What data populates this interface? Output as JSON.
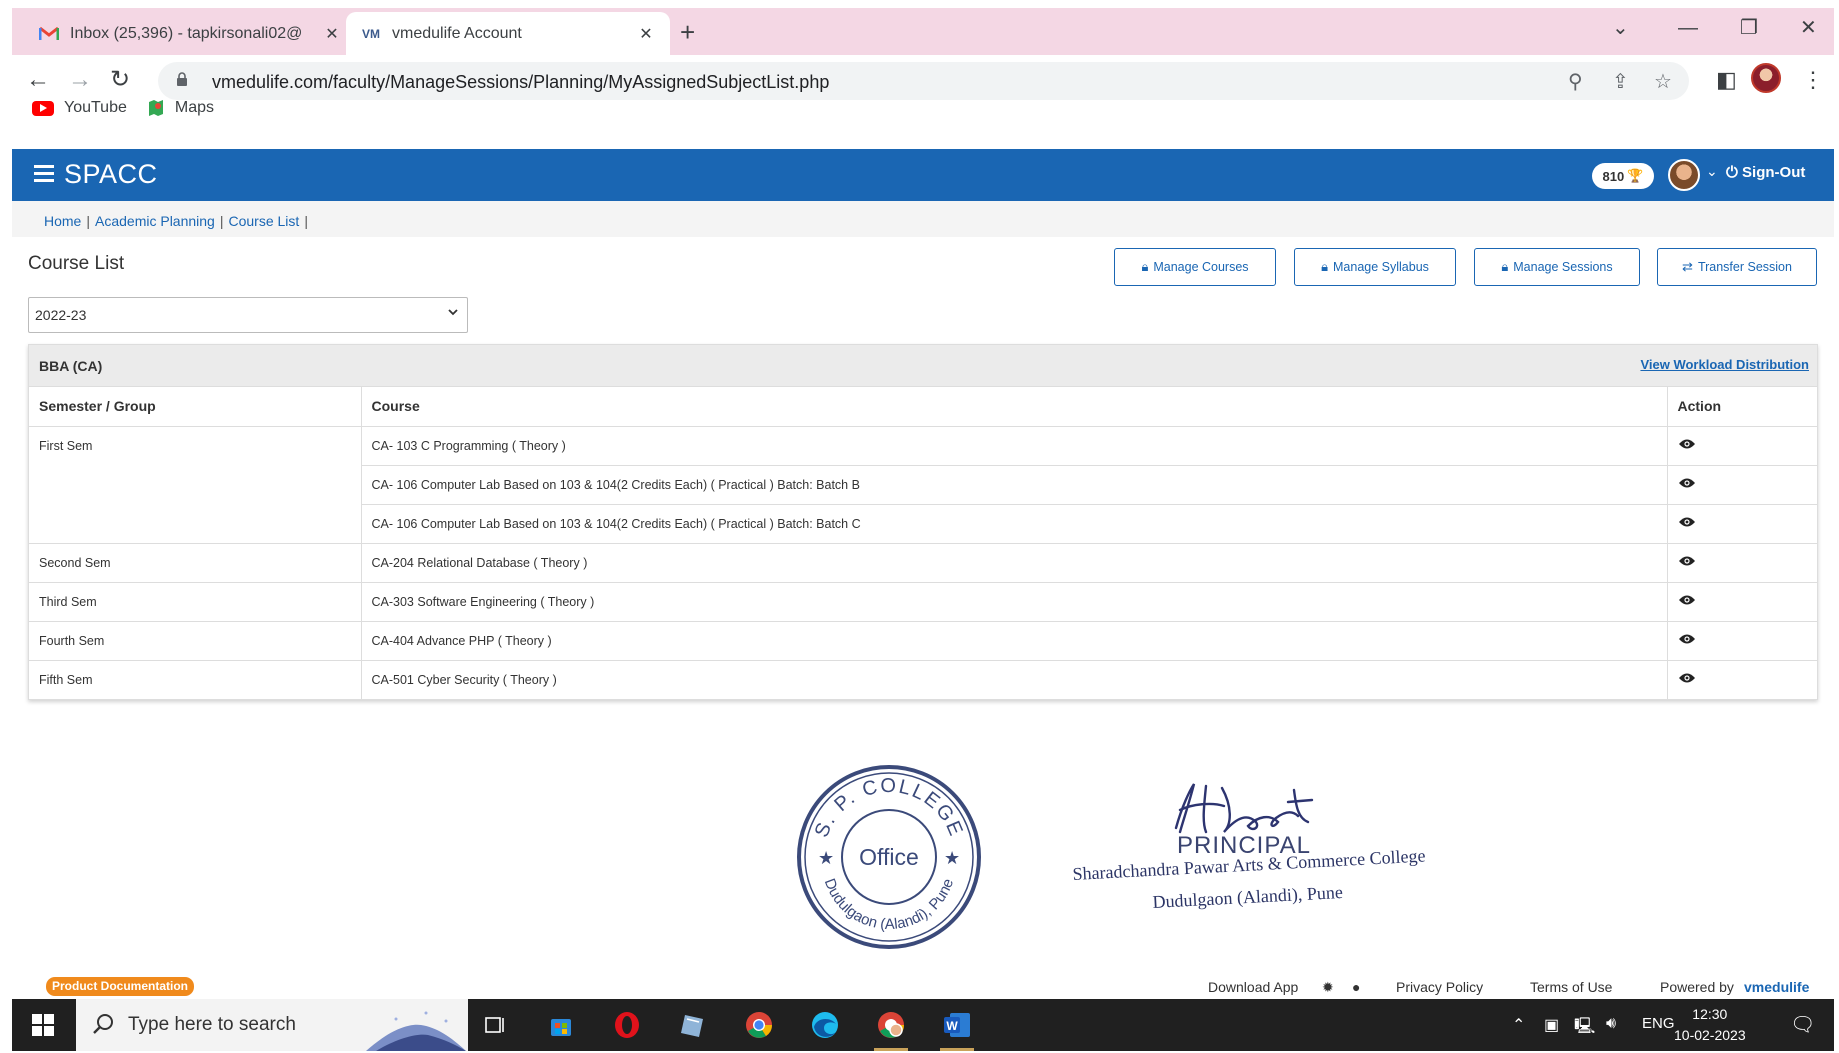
{
  "browser": {
    "tabs": [
      {
        "title": "Inbox (25,396) - tapkirsonali02@",
        "favicon": "gmail-icon",
        "active": false
      },
      {
        "title": "vmedulife Account",
        "favicon": "vmedulife-icon",
        "active": true
      }
    ],
    "url": "vmedulife.com/faculty/ManageSessions/Planning/MyAssignedSubjectList.php",
    "bookmarks": [
      {
        "label": "YouTube",
        "icon": "youtube-icon"
      },
      {
        "label": "Maps",
        "icon": "maps-icon"
      }
    ]
  },
  "app": {
    "brand": "SPACC",
    "points": "810",
    "signout_label": "Sign-Out",
    "accent_color": "#1a66b3"
  },
  "breadcrumb": [
    "Home",
    "Academic Planning",
    "Course List"
  ],
  "page": {
    "title": "Course List",
    "buttons": [
      {
        "label": "Manage Courses",
        "icon": "lock-icon"
      },
      {
        "label": "Manage Syllabus",
        "icon": "lock-icon"
      },
      {
        "label": "Manage Sessions",
        "icon": "lock-icon"
      },
      {
        "label": "Transfer Session",
        "icon": "transfer-icon"
      }
    ],
    "year": "2022-23"
  },
  "panel": {
    "program": "BBA (CA)",
    "workload_link": "View Workload Distribution",
    "columns": [
      "Semester / Group",
      "Course",
      "Action"
    ],
    "rows": [
      {
        "sem": "First Sem",
        "course": "CA- 103 C Programming ( Theory )"
      },
      {
        "sem": "",
        "course": "CA- 106 Computer Lab Based on 103 & 104(2 Credits Each) ( Practical ) Batch: Batch B"
      },
      {
        "sem": "",
        "course": "CA- 106 Computer Lab Based on 103 & 104(2 Credits Each) ( Practical ) Batch: Batch C"
      },
      {
        "sem": "Second Sem",
        "course": "CA-204 Relational Database ( Theory )"
      },
      {
        "sem": "Third Sem",
        "course": "CA-303 Software Engineering ( Theory )"
      },
      {
        "sem": "Fourth Sem",
        "course": "CA-404 Advance PHP ( Theory )"
      },
      {
        "sem": "Fifth Sem",
        "course": "CA-501 Cyber Security ( Theory )"
      }
    ]
  },
  "stamp": {
    "seal_top": "S. P. COLLEGE",
    "seal_center": "Office",
    "seal_bottom": "Dudulgaon (Alandi), Pune",
    "signature": "Bhosale",
    "principal": "PRINCIPAL",
    "college": "Sharadchandra Pawar Arts & Commerce College",
    "place": "Dudulgaon (Alandi), Pune"
  },
  "footer": {
    "doc_badge": "Product Documentation",
    "download_app": "Download App",
    "privacy": "Privacy Policy",
    "terms": "Terms of Use",
    "powered_by": "Powered by",
    "powered_brand": "vmedulife"
  },
  "taskbar": {
    "search_placeholder": "Type here to search",
    "language": "ENG",
    "time": "12:30",
    "date": "10-02-2023"
  }
}
